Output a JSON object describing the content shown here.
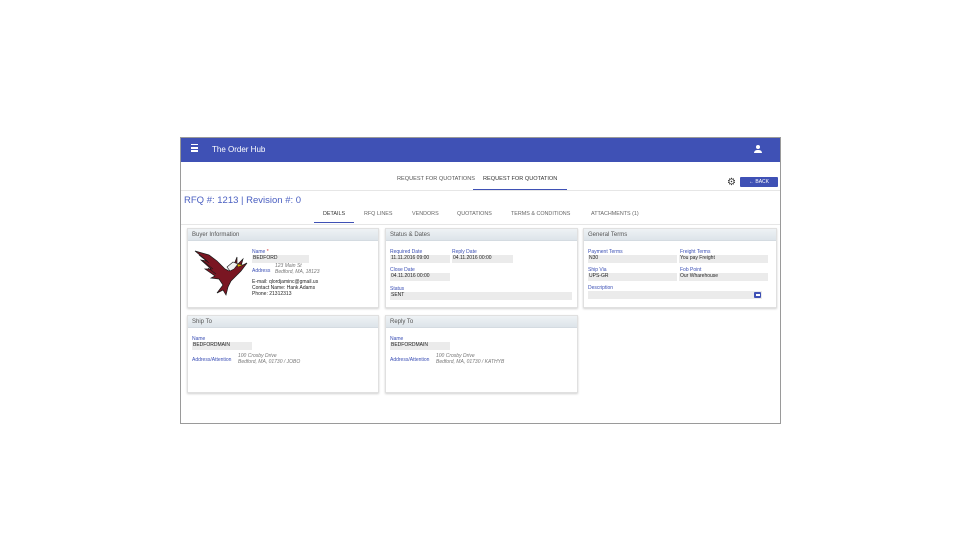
{
  "app": {
    "title": "The Order Hub"
  },
  "top_tabs": [
    "REQUEST FOR QUOTATIONS",
    "REQUEST FOR QUOTATION"
  ],
  "back_label": "← BACK",
  "rfq_title": "RFQ #: 1213 | Revision #: 0",
  "sub_tabs": [
    "DETAILS",
    "RFQ LINES",
    "VENDORS",
    "QUOTATIONS",
    "TERMS & CONDITIONS",
    "ATTACHMENTS (1)"
  ],
  "icons": {
    "menu": "menu-icon",
    "user": "user-icon",
    "settings": "gear-icon",
    "description": "comment-icon",
    "logo": "eagle-logo"
  },
  "colors": {
    "accent": "#3f51b5",
    "link_label": "#3b4fb5",
    "required": "#d32f2f",
    "logo_red": "#7a1622"
  },
  "buyer": {
    "header": "Buyer Information",
    "name_label": "Name",
    "name_value": "BEDFORD",
    "address_label": "Address",
    "address_line1": "123 Main St",
    "address_line2": "Bedford, MA, 18123",
    "email_label": "E-mail:",
    "email_value": "qlordjaminc@gmail.us",
    "contact_label": "Contact Name:",
    "contact_value": "Hank Adams",
    "phone_label": "Phone:",
    "phone_value": "21312313"
  },
  "status": {
    "header": "Status & Dates",
    "required_date_label": "Required Date",
    "required_date_value": "11.11.2016 09:00",
    "reply_date_label": "Reply Date",
    "reply_date_value": "04.11.2016 00:00",
    "close_date_label": "Close Date",
    "close_date_value": "04.11.2016 00:00",
    "status_label": "Status",
    "status_value": "SENT"
  },
  "terms": {
    "header": "General Terms",
    "payment_terms_label": "Payment Terms",
    "payment_terms_value": "N30",
    "freight_terms_label": "Freight Terms",
    "freight_terms_value": "You pay Freight",
    "ship_via_label": "Ship Via",
    "ship_via_value": "UPS-GR",
    "fob_point_label": "Fob Point",
    "fob_point_value": "Our Wharehouse",
    "description_label": "Description",
    "description_value": ""
  },
  "ship_to": {
    "header": "Ship To",
    "name_label": "Name",
    "name_value": "BEDFORDMAIN",
    "address_label": "Address/Attention",
    "address_line1": "100 Crosby Drive",
    "address_line2": "Bedford, MA, 01730 / JOBO"
  },
  "reply_to": {
    "header": "Reply To",
    "name_label": "Name",
    "name_value": "BEDFORDMAIN",
    "address_label": "Address/Attention",
    "address_line1": "100 Crosby Drive",
    "address_line2": "Bedford, MA, 01730 / KATHYB"
  }
}
